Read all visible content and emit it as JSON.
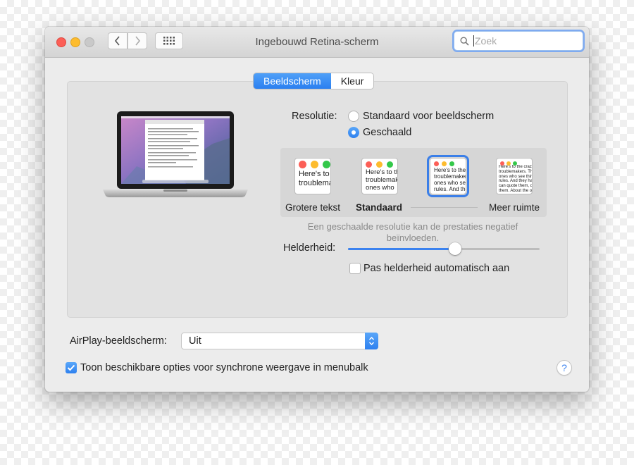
{
  "window": {
    "title": "Ingebouwd Retina-scherm",
    "search_placeholder": "Zoek"
  },
  "tabs": [
    {
      "label": "Beeldscherm",
      "selected": true
    },
    {
      "label": "Kleur",
      "selected": false
    }
  ],
  "resolution": {
    "label": "Resolutie:",
    "options": [
      {
        "label": "Standaard voor beeldscherm",
        "selected": false
      },
      {
        "label": "Geschaald",
        "selected": true
      }
    ]
  },
  "scaling": {
    "options": [
      {
        "label": "Grotere tekst",
        "preview": "Here's to th\ntroublemak",
        "selected": false
      },
      {
        "label": "Standaard",
        "preview": "Here's to th\ntroublemak\nones who",
        "selected": false
      },
      {
        "label": "",
        "preview": "Here's to the cr\ntroublemakers.\nones who see t\nrules. And they",
        "selected": true
      },
      {
        "label": "Meer ruimte",
        "preview": "Here's to the crazy one\ntroublemakers. The ro\nones who see things di\nrules. And they have n\ncan quote them, disagr\nthem. About the only th\nBecause they change t",
        "selected": false
      }
    ],
    "hint": "Een geschaalde resolutie kan de prestaties negatief beïnvloeden."
  },
  "brightness": {
    "label": "Helderheid:",
    "value": 0.56,
    "auto_label": "Pas helderheid automatisch aan",
    "auto_checked": false
  },
  "airplay": {
    "label": "AirPlay-beeldscherm:",
    "value": "Uit"
  },
  "mirroring": {
    "label": "Toon beschikbare opties voor synchrone weergave in menubalk",
    "checked": true
  },
  "help": "?",
  "colors": {
    "accent": "#3b82ef",
    "close": "#fc5f57",
    "minimize": "#fdbc2e"
  }
}
